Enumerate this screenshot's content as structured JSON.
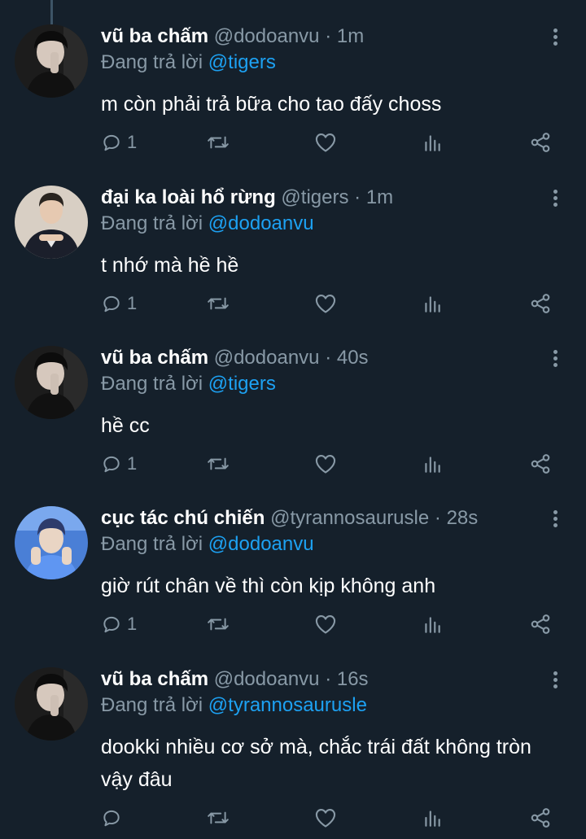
{
  "tweets": [
    {
      "name": "vũ ba chấm",
      "handle": "@dodoanvu",
      "time": "1m",
      "reply_prefix": "Đang trả lời",
      "reply_to": "@tigers",
      "text_lines": [
        "m còn phải trả bữa cho tao đấy choss"
      ],
      "reply_count": "1",
      "avatar": "avatar-dark-man"
    },
    {
      "name": "đại ka loài hổ rừng",
      "handle": "@tigers",
      "time": "1m",
      "reply_prefix": "Đang trả lời",
      "reply_to": "@dodoanvu",
      "text_lines": [
        "t nhớ mà hề hề"
      ],
      "reply_count": "1",
      "avatar": "avatar-suit-man"
    },
    {
      "name": "vũ ba chấm",
      "handle": "@dodoanvu",
      "time": "40s",
      "reply_prefix": "Đang trả lời",
      "reply_to": "@tigers",
      "text_lines": [
        "hề cc"
      ],
      "reply_count": "1",
      "avatar": "avatar-dark-man"
    },
    {
      "name": "cục tác chú chiến",
      "handle": "@tyrannosaurusle",
      "time": "28s",
      "reply_prefix": "Đang trả lời",
      "reply_to": "@dodoanvu",
      "text_lines": [
        "giờ rút chân về thì còn kịp không anh"
      ],
      "reply_count": "1",
      "avatar": "avatar-blue-man"
    },
    {
      "name": "vũ ba chấm",
      "handle": "@dodoanvu",
      "time": "16s",
      "reply_prefix": "Đang trả lời",
      "reply_to": "@tyrannosaurusle",
      "text_lines": [
        "dookki nhiều cơ sở mà, chắc trái đất không tròn",
        "vậy đâu"
      ],
      "reply_count": "",
      "avatar": "avatar-dark-man"
    }
  ],
  "icons": {
    "reply": "reply-icon",
    "retweet": "retweet-icon",
    "like": "like-icon",
    "analytics": "analytics-icon",
    "share": "share-icon",
    "menu": "more-vertical-icon"
  },
  "colors": {
    "background": "#15202b",
    "secondary_text": "#8899a6",
    "link": "#1da1f2"
  }
}
